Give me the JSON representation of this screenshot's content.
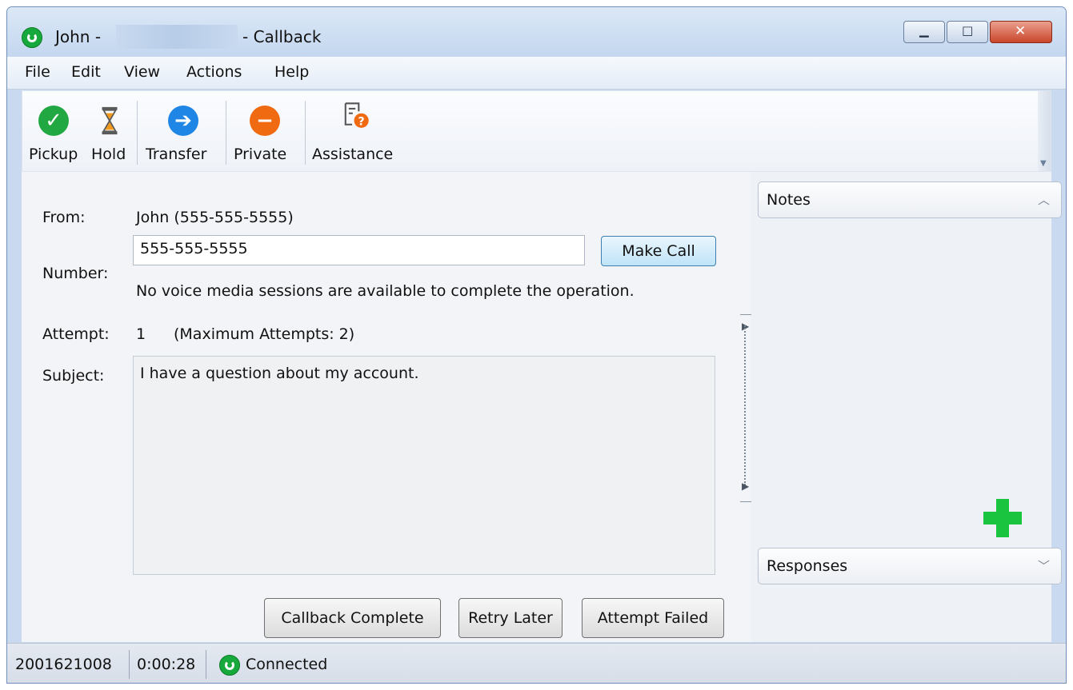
{
  "window": {
    "title_prefix": "John -",
    "title_suffix": "- Callback"
  },
  "menu": [
    "File",
    "Edit",
    "View",
    "Actions",
    "Help"
  ],
  "toolbar": {
    "pickup": "Pickup",
    "hold": "Hold",
    "transfer": "Transfer",
    "private": "Private",
    "assistance": "Assistance"
  },
  "form": {
    "from_label": "From:",
    "from_value": "John (555-555-5555)",
    "number_label": "Number:",
    "number_value": "555-555-5555",
    "make_call": "Make Call",
    "message": "No voice media sessions are available to complete the operation.",
    "attempt_label": "Attempt:",
    "attempt_value": "1",
    "attempt_max": "(Maximum Attempts: 2)",
    "subject_label": "Subject:",
    "subject_value": "I have a question about my account."
  },
  "actions": {
    "callback_complete": "Callback Complete",
    "retry_later": "Retry Later",
    "attempt_failed": "Attempt Failed"
  },
  "side": {
    "notes": "Notes",
    "responses": "Responses"
  },
  "status": {
    "id": "2001621008",
    "duration": "0:00:28",
    "state": "Connected"
  },
  "colors": {
    "pickup": "#22a843",
    "transfer": "#1f86e6",
    "private": "#f06a12",
    "assistance": "#f06a12",
    "add": "#1bc43f"
  }
}
